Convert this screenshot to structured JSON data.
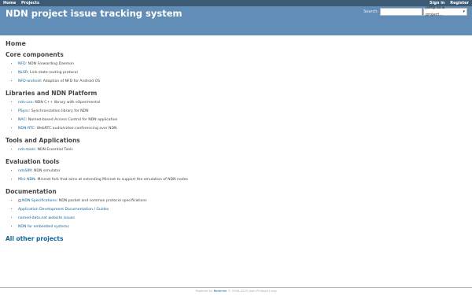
{
  "top_menu": {
    "home": "Home",
    "projects": "Projects",
    "sign_in": "Sign in",
    "register": "Register"
  },
  "header": {
    "title": "NDN project issue tracking system",
    "search_label": "Search:",
    "search_value": "",
    "jump_label": "Jump to a project...",
    "jump_icon": "chevron-down-icon"
  },
  "page_title": "Home",
  "sections": [
    {
      "title": "Core components",
      "items": [
        {
          "name": "NFD",
          "desc": ": NDN Forwarding Daemon"
        },
        {
          "name": "NLSR",
          "desc": ": Link-state routing protocol"
        },
        {
          "name": "NFD-android",
          "desc": ": Adaption of NFD for Android OS"
        }
      ]
    },
    {
      "title": "Libraries and NDN Platform",
      "items": [
        {
          "name": "ndn-cxx",
          "desc": ": NDN C++ library with eXperimental"
        },
        {
          "name": "PSync",
          "desc": ": Synchronization library for NDN"
        },
        {
          "name": "NAC",
          "desc": ": Named-based Access Control for NDN application"
        },
        {
          "name": "NDN-RTC",
          "desc": ": WebRTC audio/video conferencing over NDN"
        }
      ]
    },
    {
      "title": "Tools and Applications",
      "items": [
        {
          "name": "ndn-tools",
          "desc": ": NDN Essential Tools"
        }
      ]
    },
    {
      "title": "Evaluation tools",
      "items": [
        {
          "name": "ndnSIM",
          "desc": ": NDN simulator"
        },
        {
          "name": "Mini-NDN",
          "desc": ": Mininet fork that aims at extending Mininet to support the emulation of NDN nodes"
        }
      ]
    },
    {
      "title": "Documentation",
      "items": [
        {
          "name": "NDN Specifications",
          "desc": ": NDN packet and common protocol specifications"
        },
        {
          "name": "Application Development Documentation / Guides",
          "desc": ""
        },
        {
          "name": "named-data.net website issues",
          "desc": ""
        },
        {
          "name": "NDN for embedded systems",
          "desc": ""
        }
      ]
    }
  ],
  "all_projects": "All other projects",
  "footer": {
    "powered_by": "Powered by",
    "redmine": "Redmine",
    "copyright": "© 2006-2025 Jean-Philippe Lang"
  },
  "colors": {
    "top_bar": "#3e5b76",
    "header": "#628db6",
    "link": "#169"
  }
}
